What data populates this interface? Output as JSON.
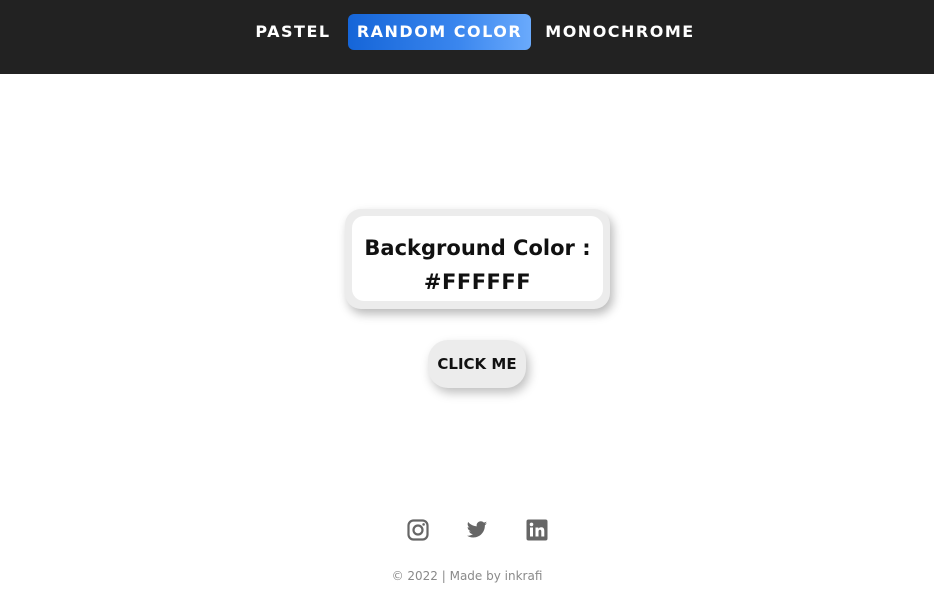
{
  "nav": {
    "items": [
      {
        "label": "PASTEL",
        "active": false
      },
      {
        "label": "RANDOM COLOR",
        "active": true
      },
      {
        "label": "MONOCHROME",
        "active": false
      }
    ]
  },
  "card": {
    "label": "Background Color :",
    "value": "#FFFFFF"
  },
  "button": {
    "label": "CLICK ME"
  },
  "social": {
    "icons": [
      "instagram-icon",
      "twitter-icon",
      "linkedin-icon"
    ]
  },
  "footer": {
    "text": "© 2022 | Made by inkrafi"
  },
  "colors": {
    "navbar_bg": "#222222",
    "accent": "#1565d8",
    "page_bg": "#FFFFFF",
    "icon": "#666666"
  }
}
